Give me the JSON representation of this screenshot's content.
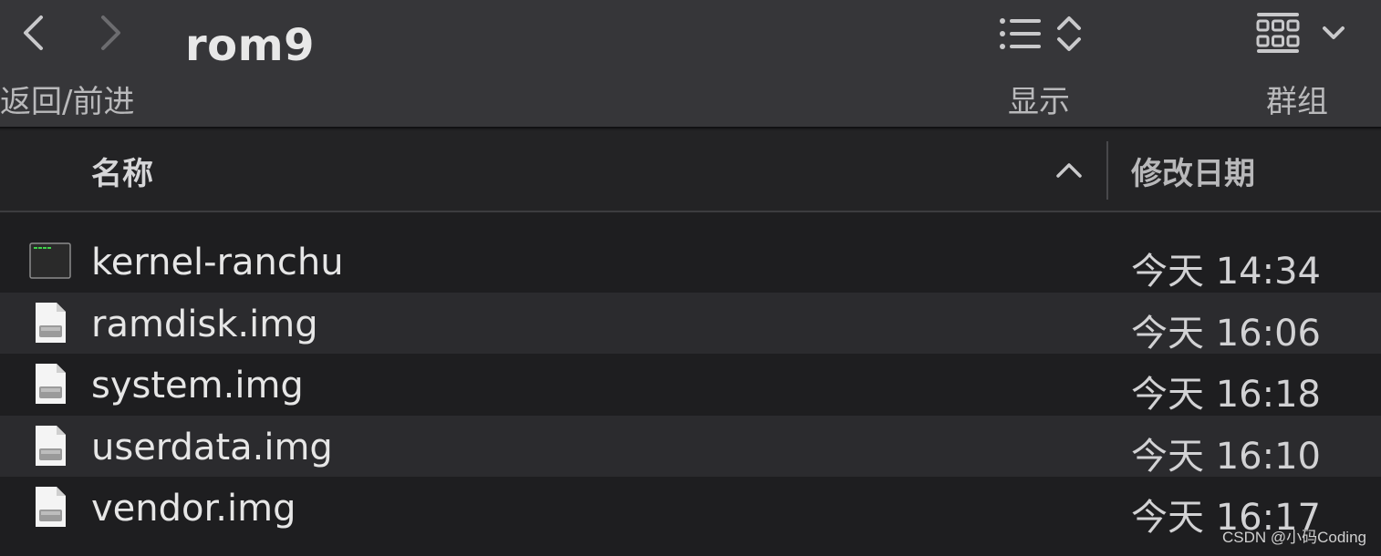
{
  "toolbar": {
    "title": "rom9",
    "nav_label": "返回/前进",
    "view_label": "显示",
    "group_label": "群组",
    "icons": {
      "back": "chevron-left-icon",
      "forward": "chevron-right-icon",
      "view": "list-view-icon",
      "view_sort": "up-down-chevron-icon",
      "group": "grid-group-icon",
      "group_menu": "chevron-down-icon"
    }
  },
  "columns": {
    "name": "名称",
    "date": "修改日期",
    "sort_indicator": "chevron-up-icon"
  },
  "files": [
    {
      "name": "kernel-ranchu",
      "date": "今天 14:34",
      "icon": "terminal-exec-icon"
    },
    {
      "name": "ramdisk.img",
      "date": "今天 16:06",
      "icon": "disk-image-icon"
    },
    {
      "name": "system.img",
      "date": "今天 16:18",
      "icon": "disk-image-icon"
    },
    {
      "name": "userdata.img",
      "date": "今天 16:10",
      "icon": "disk-image-icon"
    },
    {
      "name": "vendor.img",
      "date": "今天 16:17",
      "icon": "disk-image-icon"
    }
  ],
  "watermark": "CSDN @小码Coding",
  "colors": {
    "toolbar_bg": "#363639",
    "list_bg": "#1e1e20",
    "row_alt_bg": "#2b2b2e",
    "text": "#e6e6e6"
  }
}
